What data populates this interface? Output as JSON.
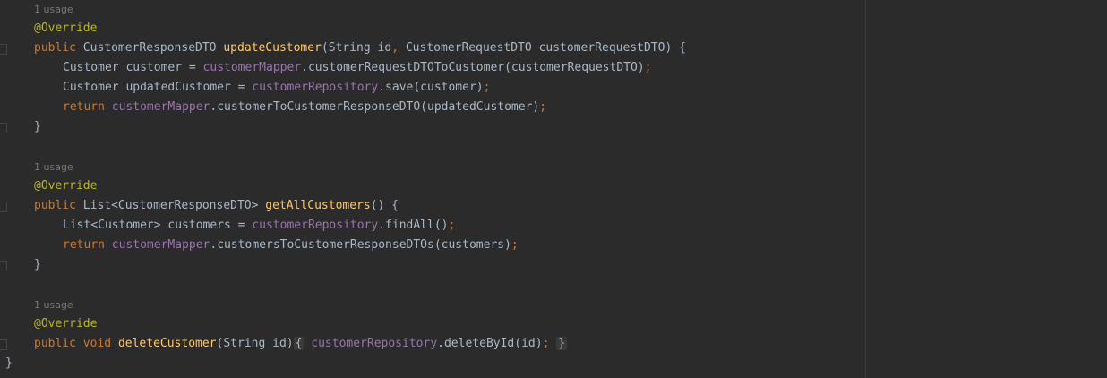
{
  "editor": {
    "usage_hint": "1 usage",
    "annotation": "@Override",
    "method1": {
      "kw_public": "public",
      "ret_type": "CustomerResponseDTO",
      "name": "updateCustomer",
      "params_a": "(String id",
      "comma": ",",
      "params_b": " CustomerRequestDTO customerRequestDTO) {",
      "l1_type": "Customer customer = ",
      "l1_field": "customerMapper",
      "l1_call": ".customerRequestDTOToCustomer(customerRequestDTO)",
      "semi": ";",
      "l2_type": "Customer updatedCustomer = ",
      "l2_field": "customerRepository",
      "l2_call": ".save(customer)",
      "l3_kw": "return",
      "l3_field": "customerMapper",
      "l3_call": ".customerToCustomerResponseDTO(updatedCustomer)",
      "close": "}"
    },
    "method2": {
      "kw_public": "public",
      "ret_type": "List<CustomerResponseDTO>",
      "name": "getAllCustomers",
      "params": "() {",
      "l1_type": "List<Customer> customers = ",
      "l1_field": "customerRepository",
      "l1_call": ".findAll()",
      "l2_kw": "return",
      "l2_field": "customerMapper",
      "l2_call": ".customersToCustomerResponseDTOs(customers)",
      "close": "}"
    },
    "method3": {
      "kw_public": "public",
      "kw_void": "void",
      "name": "deleteCustomer",
      "params": "(String id)",
      "open_brace": "{",
      "field": "customerRepository",
      "call": ".deleteById(id)",
      "semi": ";",
      "close_brace": "}"
    },
    "class_close": "}"
  }
}
